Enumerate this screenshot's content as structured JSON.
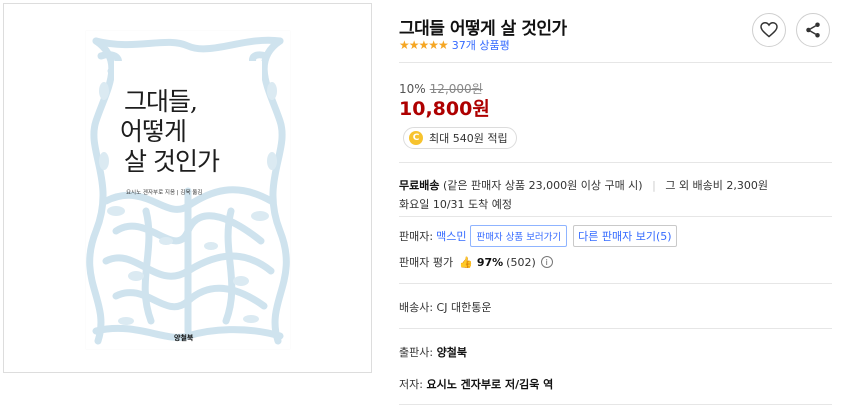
{
  "product": {
    "title": "그대들 어떻게 살 것인가",
    "stars": "★★★★★",
    "review_count": "37개 상품평"
  },
  "book_cover": {
    "title_line1": "그대들,",
    "title_line2": "어떻게",
    "title_line3": "살 것인가",
    "author_line": "요시노 겐자부로 지음 | 김욱 옮김",
    "publisher_logo": "양철북",
    "pattern_color": "#cfe3ee"
  },
  "price": {
    "discount_rate": "10%",
    "original_price": "12,000원",
    "sale_price": "10,800원"
  },
  "points": {
    "coin_icon": "C",
    "label": "최대 540원 적립"
  },
  "shipping": {
    "free_label": "무료배송",
    "free_condition": "(같은 판매자 상품 23,000원 이상 구매 시)",
    "other_fee": "그 외 배송비 2,300원",
    "arrival": "화요일 10/31 도착 예정"
  },
  "seller": {
    "label": "판매자:",
    "name": "맥스민",
    "view_products": "판매자 상품 보러가기",
    "other_sellers": "다른 판매자 보기(5)",
    "rating_label": "판매자 평가",
    "rating_pct": "97%",
    "rating_count": "(502)"
  },
  "courier": {
    "text": "배송사: CJ 대한통운"
  },
  "publisher": {
    "label": "출판사:",
    "value": "양철북"
  },
  "author": {
    "label": "저자:",
    "value": "요시노 겐자부로 저/김욱 역"
  },
  "colors": {
    "accent": "#346aff",
    "sale_red": "#ae0000",
    "star": "#f5a623"
  }
}
